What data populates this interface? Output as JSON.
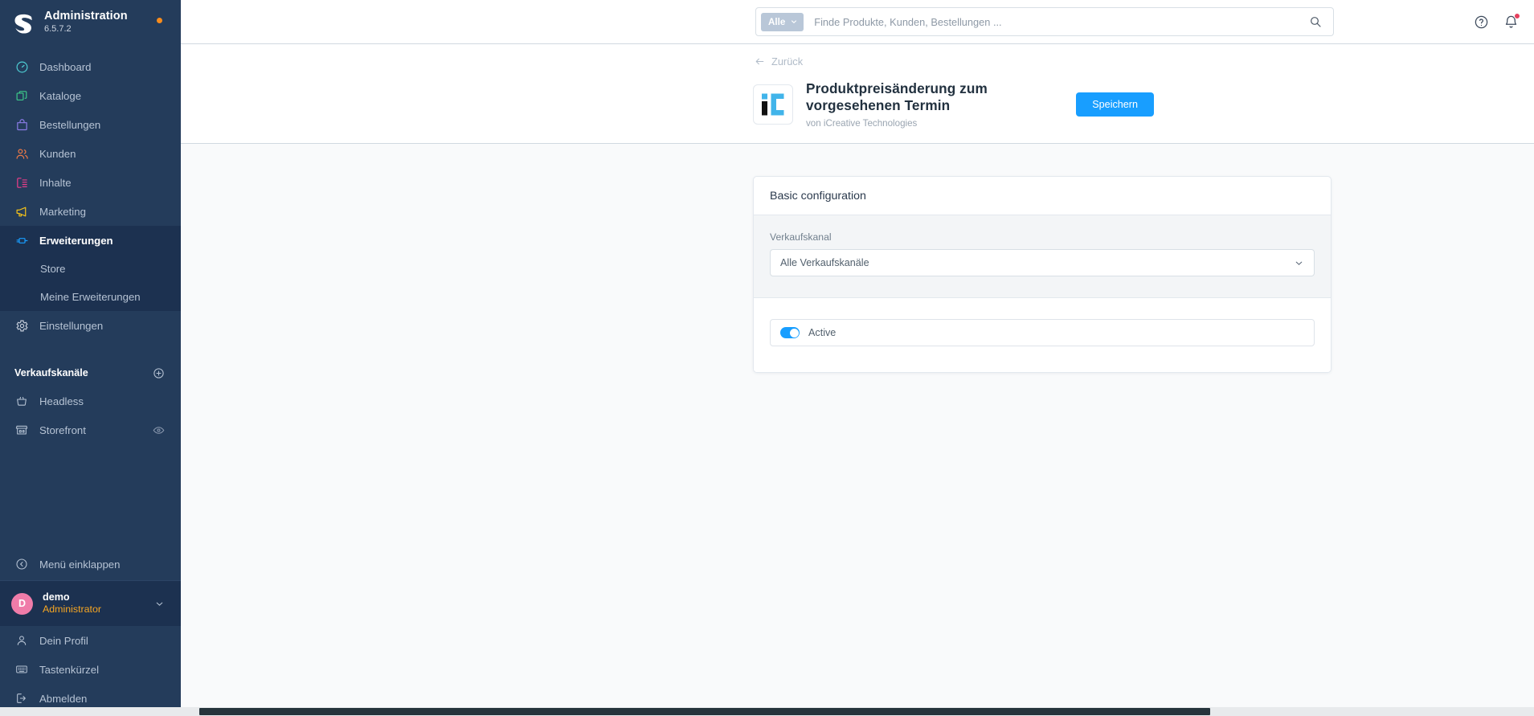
{
  "sidebar": {
    "brand": {
      "title": "Administration",
      "version": "6.5.7.2",
      "logo_icon": "shopware-logo-icon",
      "status_dot_color": "#f88c1c"
    },
    "items": [
      {
        "label": "Dashboard",
        "icon": "dashboard-icon",
        "color": "#4ecdd4",
        "active": false
      },
      {
        "label": "Kataloge",
        "icon": "catalog-icon",
        "color": "#3cc98a",
        "active": false
      },
      {
        "label": "Bestellungen",
        "icon": "orders-bag-icon",
        "color": "#8b7ce8",
        "active": false
      },
      {
        "label": "Kunden",
        "icon": "customers-icon",
        "color": "#ef7a46",
        "active": false
      },
      {
        "label": "Inhalte",
        "icon": "content-icon",
        "color": "#ee3d8b",
        "active": false
      },
      {
        "label": "Marketing",
        "icon": "marketing-megaphone-icon",
        "color": "#f5c319",
        "active": false
      },
      {
        "label": "Erweiterungen",
        "icon": "extensions-plug-icon",
        "color": "#189eff",
        "active": true
      }
    ],
    "subitems": [
      {
        "label": "Store"
      },
      {
        "label": "Meine Erweiterungen"
      }
    ],
    "settings": {
      "label": "Einstellungen",
      "icon": "gear-icon",
      "color": "#c6cedb"
    },
    "saleschannels": {
      "title": "Verkaufskanäle",
      "add_icon": "plus-circle-icon",
      "items": [
        {
          "label": "Headless",
          "icon": "basket-icon"
        },
        {
          "label": "Storefront",
          "icon": "storefront-icon",
          "trailing_icon": "eye-icon"
        }
      ]
    },
    "collapse": {
      "label": "Menü einklappen",
      "icon": "chevron-left-circle-icon"
    },
    "user": {
      "initial": "D",
      "name": "demo",
      "role": "Administrator",
      "chevron_icon": "chevron-down-icon",
      "avatar_color": "#ef7ca9"
    },
    "footer_items": [
      {
        "label": "Dein Profil",
        "icon": "user-icon"
      },
      {
        "label": "Tastenkürzel",
        "icon": "keyboard-icon"
      },
      {
        "label": "Abmelden",
        "icon": "logout-icon"
      }
    ]
  },
  "topbar": {
    "search": {
      "scope_label": "Alle",
      "scope_chevron_icon": "chevron-down-icon",
      "placeholder": "Finde Produkte, Kunden, Bestellungen ...",
      "value": "",
      "search_icon": "search-icon"
    },
    "help_icon": "help-circle-icon",
    "notifications_icon": "bell-icon",
    "notification_dot_color": "#e5405e"
  },
  "page_header": {
    "back_label": "Zurück",
    "back_icon": "arrow-left-icon",
    "plugin_logo_icon": "icreative-logo-icon",
    "title": "Produktpreisänderung zum vorgesehenen Termin",
    "vendor": "von iCreative Technologies",
    "save_label": "Speichern",
    "save_color": "#189eff"
  },
  "card": {
    "heading": "Basic configuration",
    "sales_channel": {
      "label": "Verkaufskanal",
      "value": "Alle Verkaufskanäle",
      "chevron_icon": "chevron-down-icon"
    },
    "active_toggle": {
      "label": "Active",
      "checked": true,
      "color": "#189eff"
    }
  }
}
